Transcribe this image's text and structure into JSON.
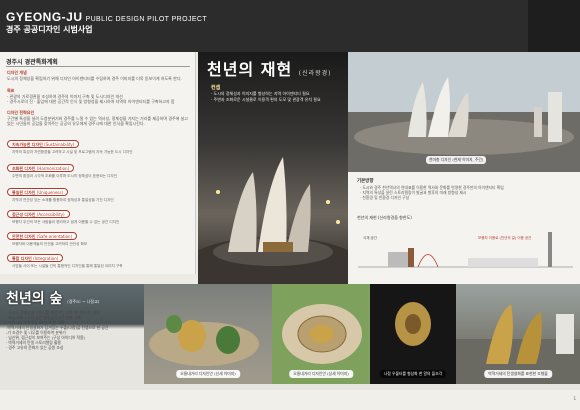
{
  "header": {
    "brand": "GYEONG-JU",
    "brand_small": "PUBLIC DESIGN PILOT PROJECT",
    "subtitle": "경주 공공디자인 시범사업"
  },
  "left": {
    "section_title": "경주시 경관특화계획",
    "blocks": [
      {
        "label": "디자인 개념",
        "text": "도시의 정체성을 확립하기 위해 디자인 아이덴티티를 수립하여 경주 이미지를 더욱 돋보이게 하도록 한다."
      },
      {
        "label": "목표",
        "text": "· 관광의 가로경관을 조성하여 경주의 이미지 구축 및 도시디자인 개선\n· 경주시로의 진 · 출입에 대한 공간적 인식 및 방향성을 제시하여 지역의 아이덴티티를 구축하고자 함"
      },
      {
        "label": "디자인 전략요인",
        "text": "구간별 특성을 살려 도청분위기와 경주를 느낄 수 있는 역사성, 정체성을 가지는 거리를 제공하며 경주에 살고 있는 시민들이 공감을 찾아주는 공공의 유무에게 경주시에 대한 인식을 확립시킨다."
      }
    ],
    "principles": [
      {
        "tag": "지속가능한 디자인",
        "en": "(Sustainability)",
        "desc": "지역의 특성과 자연환경을 고려하고 시설 및 프로그램의 지속 가능한 도시 디자인"
      },
      {
        "tag": "조화된 디자인",
        "en": "(Harmonization)",
        "desc": "주변의 환경과 시각적 조화를 이루며 도시의 정체성이 표현되는 디자인"
      },
      {
        "tag": "통일된 디자인",
        "en": "(Uniqueness)",
        "desc": "지역과 연관성 있는 소재를 활용하여 정체성과 통일성을 가진 디자인"
      },
      {
        "tag": "접근성 디자인",
        "en": "(Accessibility)",
        "desc": "보행자 우선의 모든 사람들이 편리하고 쉽게 이용할 수 있는 공간 디자인"
      },
      {
        "tag": "안전한 디자인",
        "en": "(Safe-orientation)",
        "desc": "보행자와 이용객들의 안전을 고려하여 안전성 확보"
      },
      {
        "tag": "통합 디자인",
        "en": "(Integration)",
        "desc": "사업들 사이 또는 시설들 간의 통합적인 디자인을 통해 통일된 이미지 구축"
      }
    ]
  },
  "hero": {
    "title": "천년의 재현",
    "title_sub": "(신라왕경)",
    "concept_label": "컨셉",
    "concept_lines": [
      "· 도시의 정체성과 이미지를 형성하는 지역 아이덴티티 필요",
      "· 주변과 조화로운 시설물로 이용객 편의 도모 및 관광객 유치 필요"
    ]
  },
  "photo_tr": {
    "caption": "천마총 디자인 (현재 이미지, 주간)"
  },
  "concept_box": {
    "label": "기본방향",
    "lines": [
      "· 도시와 경주 천년역사의 연대표를 이용한 역사와 문화를 반영한 경주만의 아이덴티티 확립",
      "· 지역의 특성을 살린 스토리텔링이 발굴과 향후의 미래 방향성 제시",
      "· 친환경 및 친환경 디자인 구성"
    ]
  },
  "section_box": {
    "label": "천년의 재현 (신라왕경을 향한도)",
    "annot_right": "보행자 이용로 (천년의 길) 이용 공간",
    "annot_left": "식재 공간"
  },
  "bottom": {
    "title": "천년의 숲",
    "title_sub": "(경주IC ~ 나정교)",
    "intro": [
      "· 도시의 정체성과 이미지를 형성하는 지역 아이덴티티 필요",
      "· 테니스에나 도로 공간 활용공간으로 변화 구축",
      "",
      "· 박혁거세의 탄생을 모티브로한 계획",
      "  -박혁거세의 탄생설화가 담겨있는 우물(나정)을 컨셉으로 한 공간",
      "  -기 조경수 및 나무를 이용하여 분위기",
      "· 남산위, 접근성이 보여주는 (구상 아이디어 적용)",
      "· 박혁거세의 탄생 스토리텔링 활용",
      "· 경주 고유의 문화가 있는 공원 조성"
    ],
    "captions": [
      "오릉내거리 디자인안 (신세 이미지)",
      "오릉내거리 디자인안 (상세 이미지)",
      "나정 우물터를 형상화 한 알의 돌조각",
      "박혁거세의 탄생설화를 표현한 조형물"
    ]
  },
  "page_number": "1"
}
